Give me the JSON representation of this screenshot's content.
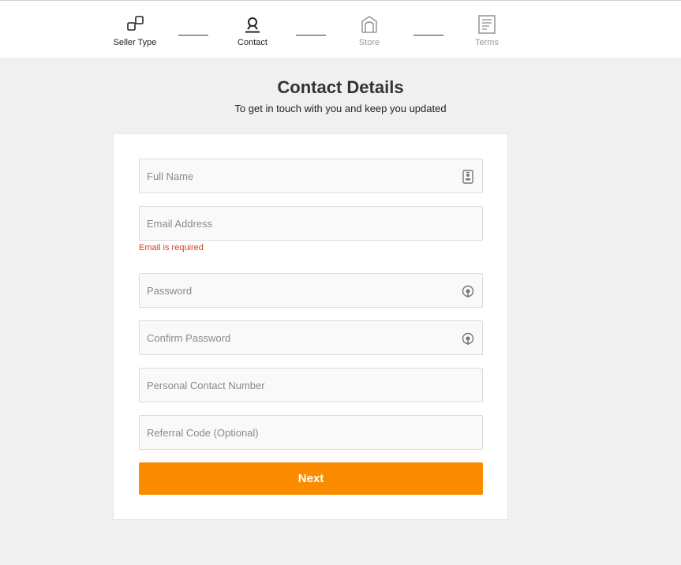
{
  "stepper": {
    "steps": [
      {
        "label": "Seller Type",
        "icon": "seller-type-icon",
        "state": "active"
      },
      {
        "label": "Contact",
        "icon": "person-icon",
        "state": "active"
      },
      {
        "label": "Store",
        "icon": "store-icon",
        "state": "inactive"
      },
      {
        "label": "Terms",
        "icon": "document-icon",
        "state": "inactive"
      }
    ]
  },
  "header": {
    "title": "Contact Details",
    "subtitle": "To get in touch with you and keep you updated"
  },
  "form": {
    "full_name": {
      "placeholder": "Full Name",
      "value": "",
      "icon": "id-card-icon"
    },
    "email": {
      "placeholder": "Email Address",
      "value": "",
      "error": "Email is required"
    },
    "password": {
      "placeholder": "Password",
      "value": "",
      "icon": "eye-icon"
    },
    "confirm_password": {
      "placeholder": "Confirm Password",
      "value": "",
      "icon": "eye-icon"
    },
    "contact_number": {
      "placeholder": "Personal Contact Number",
      "value": ""
    },
    "referral": {
      "placeholder": "Referral Code (Optional)",
      "value": ""
    },
    "next_label": "Next"
  },
  "colors": {
    "accent": "#fb8c00",
    "error": "#d23c1e",
    "background": "#f0f0f0"
  }
}
